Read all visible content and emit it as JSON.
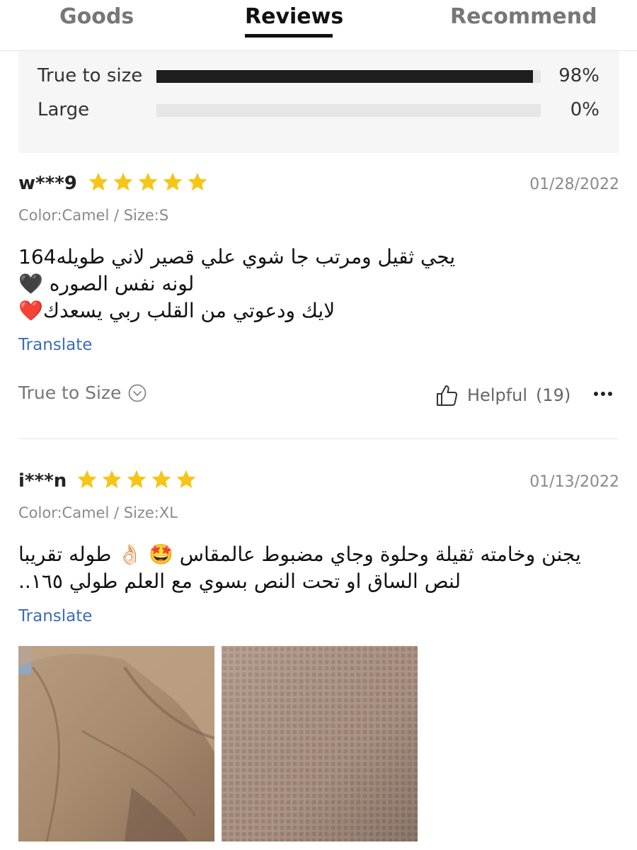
{
  "tabs": {
    "goods": "Goods",
    "reviews": "Reviews",
    "recommend": "Recommend",
    "active": "reviews"
  },
  "fit": {
    "rows": [
      {
        "label": "True to size",
        "percent_text": "98%",
        "value": 0.98
      },
      {
        "label": "Large",
        "percent_text": "0%",
        "value": 0.0
      }
    ]
  },
  "reviews": [
    {
      "user": "w***9",
      "stars": 5,
      "date": "01/28/2022",
      "meta": "Color:Camel / Size:S",
      "lines": [
        "يجي ثقيل ومرتب جا شوي علي قصير لاني طويله164",
        "لونه نفس الصوره 🖤",
        "لايك ودعوتي من القلب ربي يسعدك❤️"
      ],
      "translate": "Translate",
      "fit_label": "True to Size",
      "helpful_label": "Helpful",
      "helpful_count": "(19)"
    },
    {
      "user": "i***n",
      "stars": 5,
      "date": "01/13/2022",
      "meta": "Color:Camel / Size:XL",
      "lines": [
        "يجنن وخامته ثقيلة وحلوة وجاي مضبوط عالمقاس 🤩 👌🏻 طوله تقريبا",
        "لنص الساق او تحت النص بسوي مع العلم طولي ١٦٥.."
      ],
      "translate": "Translate"
    }
  ],
  "colors": {
    "accent_link": "#3b6db3",
    "star": "#f5c518",
    "bar_fill": "#1e1e1e",
    "bar_track": "#e6e6e6",
    "panel_bg": "#f6f6f6"
  }
}
